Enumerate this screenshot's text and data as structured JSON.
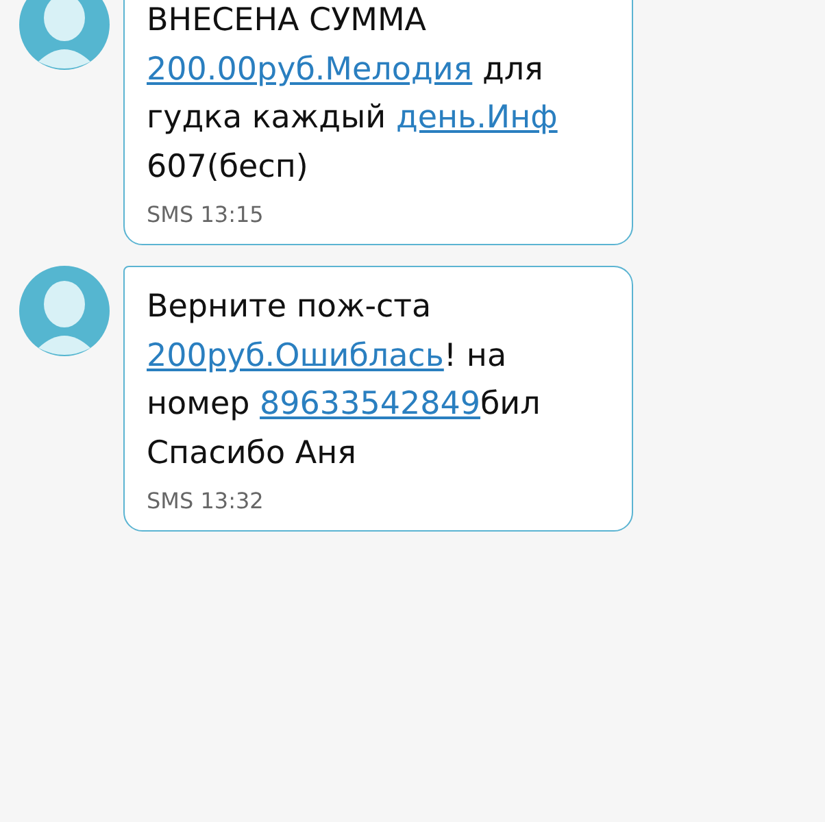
{
  "messages": [
    {
      "lines": [
        [
          {
            "kind": "text",
            "text": "ВНЕСЕНА СУММА"
          }
        ],
        [
          {
            "kind": "link",
            "text": "200.00руб.Мелодия"
          },
          {
            "kind": "text",
            "text": " для"
          }
        ],
        [
          {
            "kind": "text",
            "text": "гудка каждый "
          },
          {
            "kind": "link",
            "text": "день.Инф"
          }
        ],
        [
          {
            "kind": "text",
            "text": "607(бесп)"
          }
        ]
      ],
      "meta": "SMS 13:15"
    },
    {
      "lines": [
        [
          {
            "kind": "text",
            "text": "Верните пож-ста"
          }
        ],
        [
          {
            "kind": "link",
            "text": "200руб.Ошиблась"
          },
          {
            "kind": "text",
            "text": "! на"
          }
        ],
        [
          {
            "kind": "text",
            "text": "номер "
          },
          {
            "kind": "link",
            "text": "89633542849"
          },
          {
            "kind": "text",
            "text": "бил"
          }
        ],
        [
          {
            "kind": "text",
            "text": "Спасибо Аня"
          }
        ]
      ],
      "meta": "SMS 13:32"
    }
  ]
}
